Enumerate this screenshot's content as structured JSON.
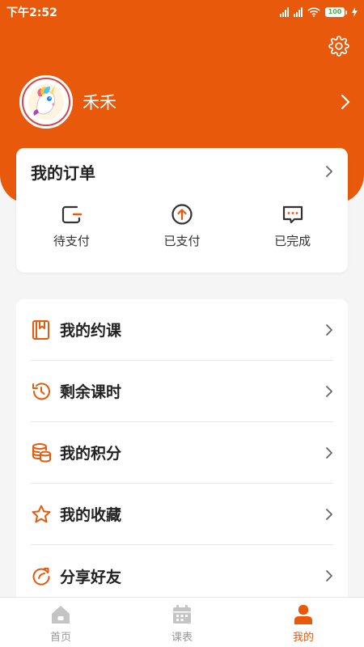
{
  "status_bar": {
    "time": "下午2:52",
    "battery": "100"
  },
  "profile": {
    "name": "禾禾"
  },
  "orders": {
    "title": "我的订单",
    "items": [
      {
        "label": "待支付",
        "icon": "wallet-icon"
      },
      {
        "label": "已支付",
        "icon": "arrow-up-circle-icon"
      },
      {
        "label": "已完成",
        "icon": "message-dots-icon"
      }
    ]
  },
  "menu": {
    "items": [
      {
        "label": "我的约课",
        "icon": "book-icon"
      },
      {
        "label": "剩余课时",
        "icon": "clock-history-icon"
      },
      {
        "label": "我的积分",
        "icon": "coins-icon"
      },
      {
        "label": "我的收藏",
        "icon": "star-icon"
      },
      {
        "label": "分享好友",
        "icon": "share-icon"
      }
    ]
  },
  "tabbar": {
    "items": [
      {
        "label": "首页",
        "icon": "home-icon"
      },
      {
        "label": "课表",
        "icon": "calendar-icon"
      },
      {
        "label": "我的",
        "icon": "user-icon",
        "active": true
      }
    ]
  },
  "colors": {
    "accent": "#e8590c",
    "tab_inactive": "#999999",
    "background": "#f5f5f5"
  }
}
